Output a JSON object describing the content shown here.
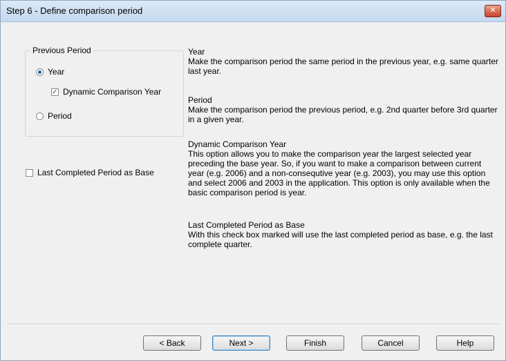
{
  "window": {
    "title": "Step 6 - Define comparison period",
    "close_glyph": "✕"
  },
  "previous_period": {
    "legend": "Previous Period",
    "year_label": "Year",
    "dynamic_label": "Dynamic Comparison Year",
    "period_label": "Period"
  },
  "last_completed_label": "Last Completed Period as Base",
  "descriptions": {
    "year_heading": "Year",
    "year_text": "Make the comparison period the same period in the previous year, e.g. same quarter last year.",
    "period_heading": "Period",
    "period_text": "Make the comparison period the previous period, e.g. 2nd quarter before 3rd quarter in a given year.",
    "dynamic_heading": "Dynamic Comparison Year",
    "dynamic_text": "This option allows you to make the comparison year the largest selected year preceding the base year. So, if you want to make a comparison between current year (e.g. 2006) and a non-consequtive year (e.g. 2003), you may use this option and select 2006 and 2003 in the application. This option is only available when the basic comparison period is year.",
    "lastcompleted_heading": "Last Completed Period as Base",
    "lastcompleted_text": "With this check box marked will use the last completed period as base, e.g. the last complete quarter."
  },
  "buttons": {
    "back": "< Back",
    "next": "Next >",
    "finish": "Finish",
    "cancel": "Cancel",
    "help": "Help"
  }
}
